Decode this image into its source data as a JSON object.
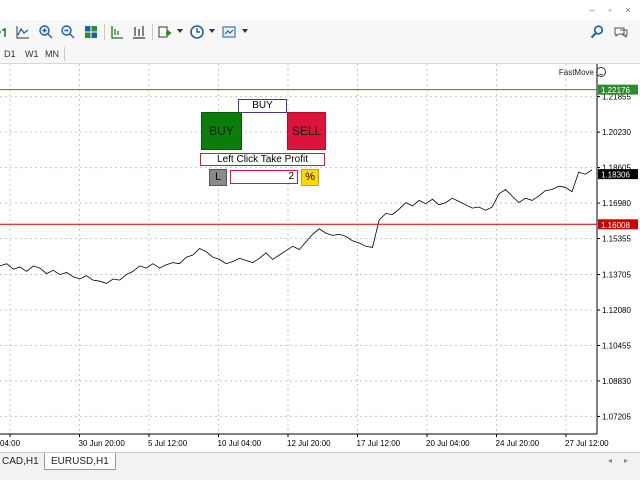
{
  "window": {
    "minimize": "–",
    "restore": "▫",
    "close": "×"
  },
  "toolbar": {
    "icons": [
      "bar-chart-icon",
      "line-chart-icon",
      "zoom-in-icon",
      "zoom-out-icon",
      "tile-windows-icon",
      "autoscroll-icon",
      "chart-shift-icon",
      "indicators-icon",
      "periodicity-icon",
      "templates-icon",
      "search-icon",
      "chat-icon"
    ]
  },
  "timeframes": [
    "D1",
    "W1",
    "MN"
  ],
  "indicator": {
    "name": "FastMove"
  },
  "panel": {
    "title": "BUY",
    "buy_label": "BUY",
    "sell_label": "SELL",
    "mode_label": "Left Click Take Profit",
    "lot_button": "L",
    "quantity": "2",
    "percent_button": "%"
  },
  "tabs": [
    "CAD,H1",
    "EURUSD,H1"
  ],
  "active_tab": "EURUSD,H1",
  "colors": {
    "buy": "#0a7d0a",
    "sell": "#dc143c",
    "take_profit_line": "#2e8b2e",
    "stop_line": "#cc0000",
    "price_line": "#000000"
  },
  "chart_data": {
    "type": "line",
    "symbol": "EURUSD",
    "timeframe": "H1",
    "y_ticks": [
      "1.21855",
      "1.20230",
      "1.18605",
      "1.16980",
      "1.15355",
      "1.13705",
      "1.12080",
      "1.10455",
      "1.08830",
      "1.07205"
    ],
    "ylim": [
      1.064,
      1.2335
    ],
    "x_ticks": [
      "04:00",
      "30 Jun 20:00",
      "5 Jul 12:00",
      "10 Jul 04:00",
      "12 Jul 20:00",
      "17 Jul 12:00",
      "20 Jul 04:00",
      "24 Jul 20:00",
      "27 Jul 12:00"
    ],
    "horizontal_lines": [
      {
        "label": "1.22176",
        "value": 1.22176,
        "color": "#2e8b2e"
      },
      {
        "label": "1.16008",
        "value": 1.16008,
        "color": "#cc0000"
      }
    ],
    "current_price": {
      "label": "1.18306",
      "value": 1.18306
    },
    "series": [
      {
        "values": [
          1.141,
          1.142,
          1.1395,
          1.1405,
          1.1385,
          1.141,
          1.14,
          1.1375,
          1.139,
          1.137,
          1.138,
          1.136,
          1.135,
          1.1365,
          1.1345,
          1.134,
          1.133,
          1.135,
          1.1345,
          1.137,
          1.1385,
          1.141,
          1.14,
          1.142,
          1.14,
          1.1415,
          1.1425,
          1.142,
          1.145,
          1.146,
          1.149,
          1.1475,
          1.145,
          1.144,
          1.142,
          1.143,
          1.1445,
          1.1435,
          1.1425,
          1.1445,
          1.147,
          1.144,
          1.146,
          1.148,
          1.15,
          1.1485,
          1.152,
          1.1555,
          1.158,
          1.156,
          1.155,
          1.1555,
          1.1545,
          1.1525,
          1.1515,
          1.15,
          1.1495,
          1.162,
          1.165,
          1.1645,
          1.167,
          1.17,
          1.1685,
          1.171,
          1.1695,
          1.1715,
          1.169,
          1.17,
          1.172,
          1.1705,
          1.169,
          1.1675,
          1.168,
          1.1665,
          1.168,
          1.174,
          1.176,
          1.173,
          1.17,
          1.172,
          1.171,
          1.173,
          1.1755,
          1.176,
          1.1775,
          1.177,
          1.175,
          1.184,
          1.183,
          1.185
        ]
      }
    ]
  }
}
